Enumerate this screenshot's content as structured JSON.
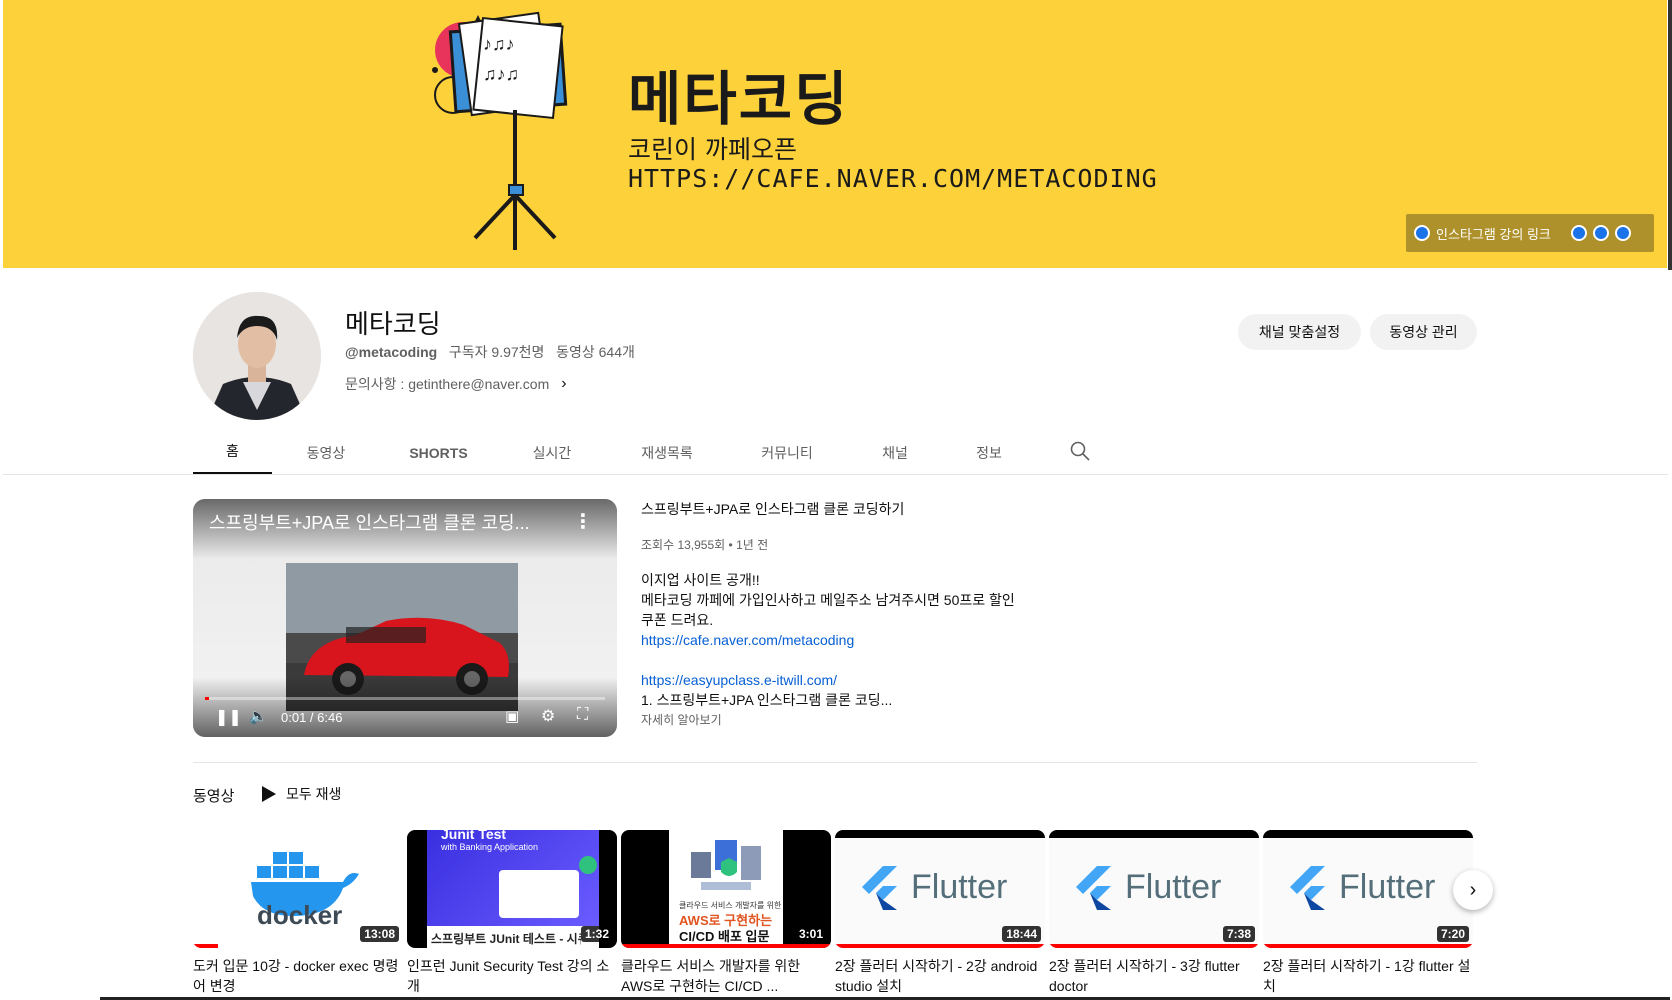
{
  "banner": {
    "title": "메타코딩",
    "line1": "코린이 까페오픈",
    "line2": "HTTPS://CAFE.NAVER.COM/METACODING",
    "link_label": "인스타그램 강의 링크",
    "accent": "#fdd13a"
  },
  "channel": {
    "name": "메타코딩",
    "handle": "@metacoding",
    "subscribers": "구독자 9.97천명",
    "videos": "동영상 644개",
    "contact": "문의사항 : getinthere@naver.com",
    "customize_button": "채널 맞춤설정",
    "manage_button": "동영상 관리"
  },
  "tabs": [
    "홈",
    "동영상",
    "SHORTS",
    "실시간",
    "재생목록",
    "커뮤니티",
    "채널",
    "정보"
  ],
  "featured": {
    "player_title": "스프링부트+JPA로 인스타그램 클론 코딩...",
    "time": "0:01 / 6:46",
    "progress": 0.003,
    "title": "스프링부트+JPA로 인스타그램 클론 코딩하기",
    "views": "조회수 13,955회 • 1년 전",
    "desc_line1": "이지업 사이트 공개!!",
    "desc_line2": "메타코딩 까페에 가입인사하고 메일주소 남겨주시면 50프로 할인 쿠폰 드려요.",
    "link1": "https://cafe.naver.com/metacoding",
    "link2": "https://easyupclass.e-itwill.com/",
    "desc_line3": "1. 스프링부트+JPA 인스타그램 클론 코딩...",
    "more": "자세히 알아보기"
  },
  "shelf": {
    "title": "동영상",
    "play_all": "모두 재생",
    "videos": [
      {
        "title": "도커 입문 10강 - docker exec 명령어 변경",
        "duration": "13:08",
        "thumb": "docker",
        "thumb_text": "docker",
        "watched": 0.12
      },
      {
        "title": "인프런 Junit Security Test 강의 소개",
        "duration": "1:32",
        "thumb": "junit",
        "thumb_text": "Junit Test",
        "thumb_sub": "with Banking Application",
        "thumb_caption": "스프링부트 JUnit 테스트 - 시큐",
        "watched": 0.0
      },
      {
        "title": "클라우드 서비스 개발자를 위한 AWS로 구현하는 CI/CD ...",
        "duration": "3:01",
        "thumb": "aws",
        "thumb_top": "클라우드 서비스 개발자를 위한",
        "thumb_mid": "AWS로 구현하는",
        "thumb_bot": "CI/CD 배포 입문",
        "watched": 1.0
      },
      {
        "title": "2장 플러터 시작하기 - 2강 android studio 설치",
        "duration": "18:44",
        "thumb": "flutter",
        "thumb_text": "Flutter",
        "watched": 1.0
      },
      {
        "title": "2장 플러터 시작하기 - 3강 flutter doctor",
        "duration": "7:38",
        "thumb": "flutter",
        "thumb_text": "Flutter",
        "watched": 1.0
      },
      {
        "title": "2장 플러터 시작하기 - 1강 flutter 설치",
        "duration": "7:20",
        "thumb": "flutter",
        "thumb_text": "Flutter",
        "watched": 1.0
      }
    ]
  }
}
